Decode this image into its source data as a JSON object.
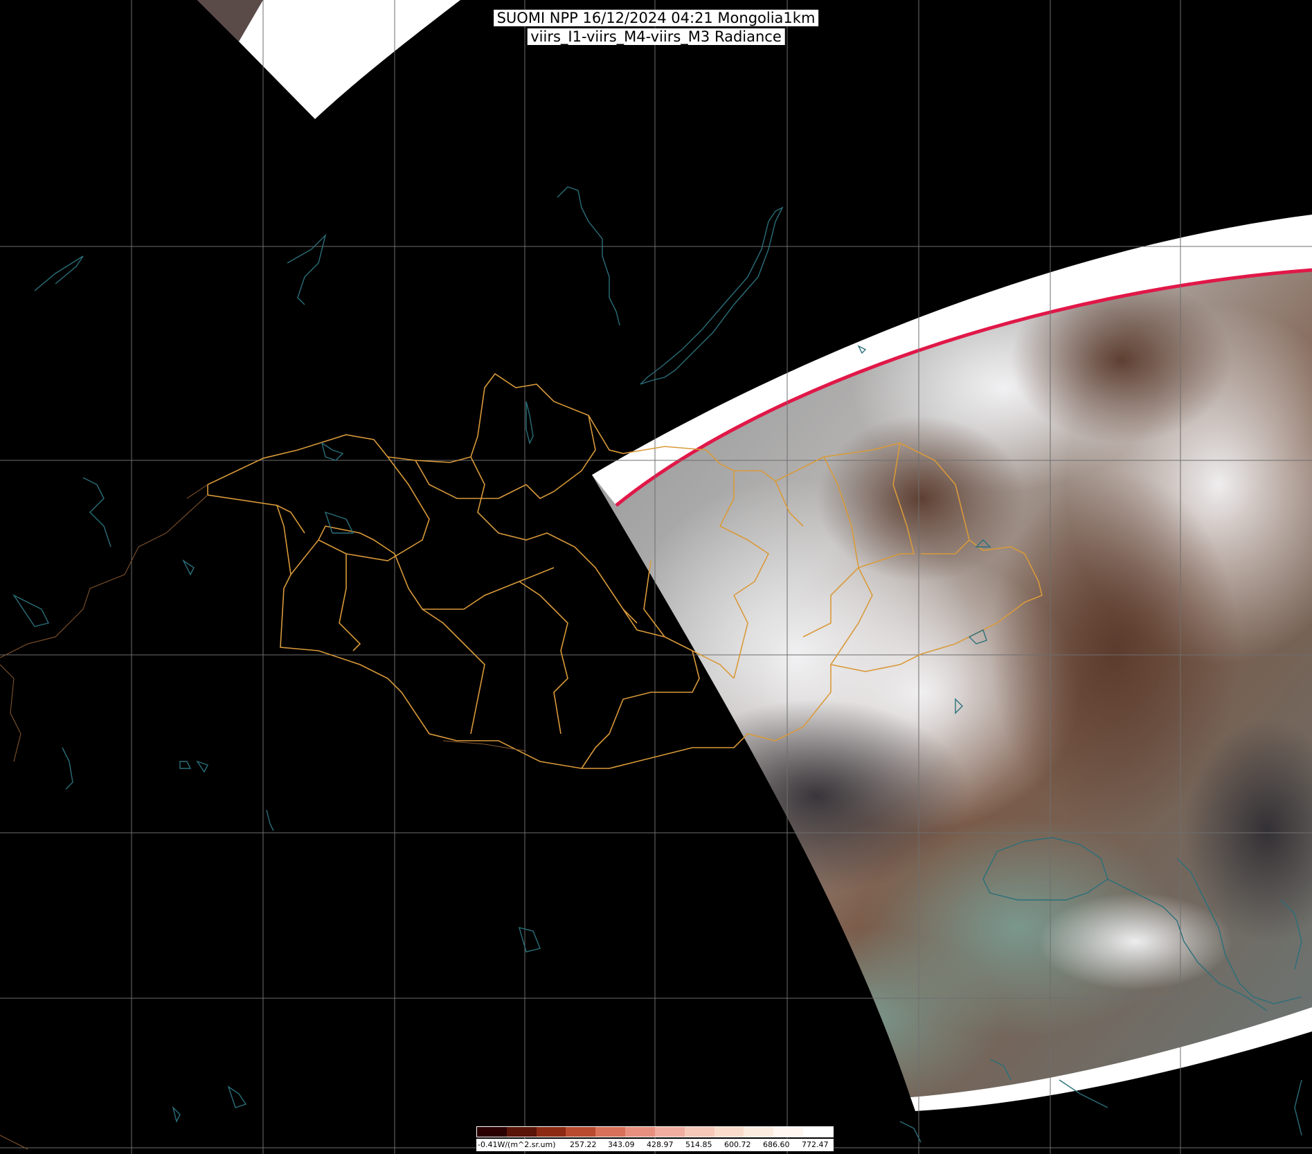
{
  "title": {
    "line1": "SUOMI NPP 16/12/2024 04:21 Mongolia1km",
    "line2": "viirs_I1-viirs_M4-viirs_M3 Radiance"
  },
  "colorbar": {
    "unit_label": "-0.41W/(m^2.sr.um)",
    "ticks": [
      "257.22",
      "343.09",
      "428.97",
      "514.85",
      "600.72",
      "686.60",
      "772.47"
    ],
    "colors": [
      "#2a0000",
      "#5a1408",
      "#8c2a14",
      "#b84a30",
      "#d8705a",
      "#e89080",
      "#f0aea0",
      "#f6c8b8",
      "#fadccc",
      "#fcece0",
      "#fef6f0",
      "#ffffff"
    ]
  },
  "map": {
    "background": "#000000",
    "grid_color": "#6e6e6e",
    "border_color": "#d99a3a",
    "coast_color": "#2a6f7a",
    "swath_edge_color": "#e01848"
  }
}
